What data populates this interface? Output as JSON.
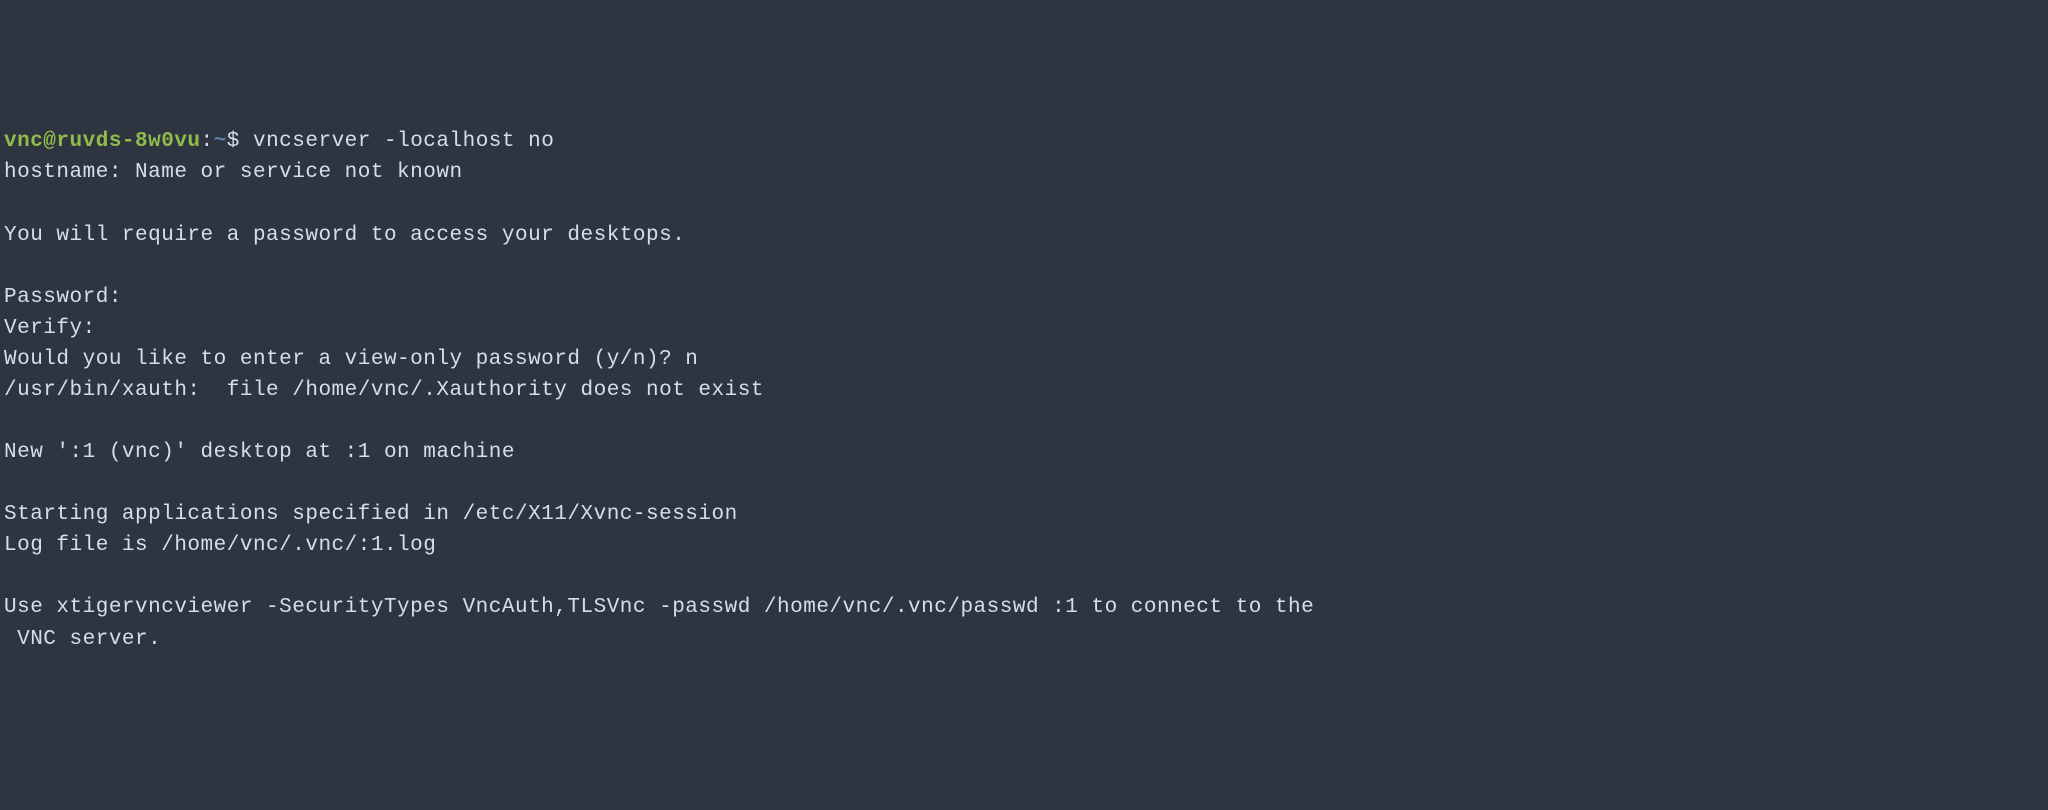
{
  "prompt": {
    "user_host": "vnc@ruvds-8w0vu",
    "sep1": ":",
    "path": "~",
    "sep2": "$ "
  },
  "command": "vncserver -localhost no",
  "lines": {
    "l1": "hostname: Name or service not known",
    "l2": "",
    "l3": "You will require a password to access your desktops.",
    "l4": "",
    "l5": "Password:",
    "l6": "Verify:",
    "l7": "Would you like to enter a view-only password (y/n)? n",
    "l8": "/usr/bin/xauth:  file /home/vnc/.Xauthority does not exist",
    "l9": "",
    "l10": "New ':1 (vnc)' desktop at :1 on machine",
    "l11": "",
    "l12": "Starting applications specified in /etc/X11/Xvnc-session",
    "l13": "Log file is /home/vnc/.vnc/:1.log",
    "l14": "",
    "l15": "Use xtigervncviewer -SecurityTypes VncAuth,TLSVnc -passwd /home/vnc/.vnc/passwd :1 to connect to the",
    "l16": " VNC server."
  }
}
